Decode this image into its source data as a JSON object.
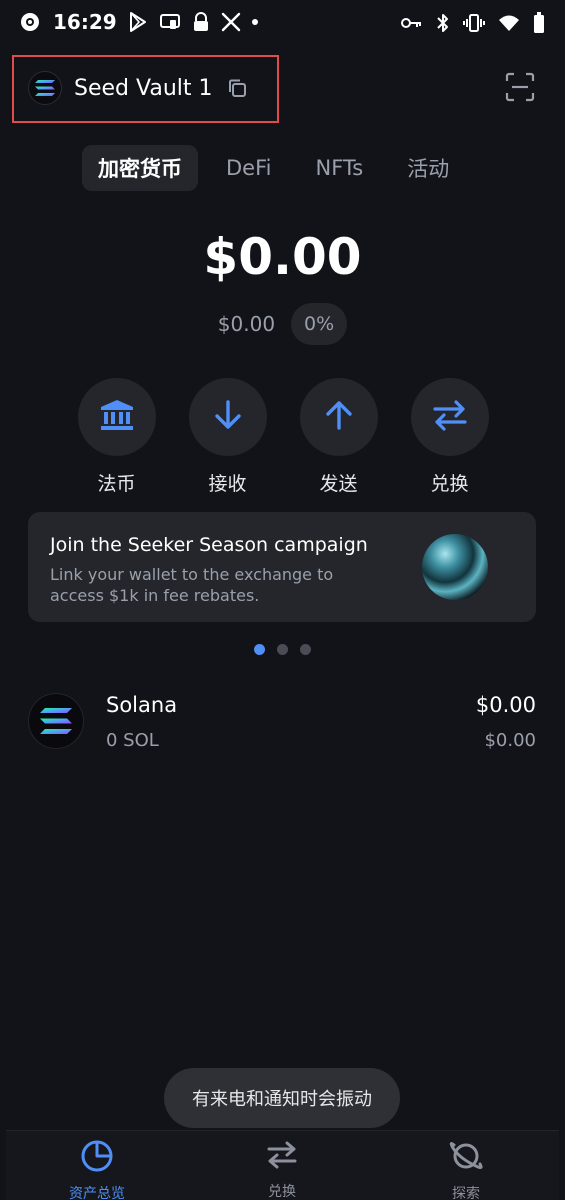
{
  "status_bar": {
    "time": "16:29",
    "left_icons": [
      "notification-app-icon",
      "play-store-icon",
      "cast-icon",
      "lock-icon",
      "x-app-icon",
      "dot-icon"
    ],
    "right_icons": [
      "vpn-key-icon",
      "bluetooth-icon",
      "vibrate-icon",
      "wifi-icon",
      "battery-icon"
    ]
  },
  "header": {
    "account_name": "Seed Vault 1",
    "copy_icon": "copy-icon",
    "scan_icon": "scan-icon"
  },
  "tabs": [
    {
      "label": "加密货币",
      "active": true
    },
    {
      "label": "DeFi",
      "active": false
    },
    {
      "label": "NFTs",
      "active": false
    },
    {
      "label": "活动",
      "active": false
    }
  ],
  "balance": {
    "total": "$0.00",
    "change_amount": "$0.00",
    "change_percent": "0%"
  },
  "actions": [
    {
      "label": "法币",
      "icon": "bank-icon"
    },
    {
      "label": "接收",
      "icon": "arrow-down-icon"
    },
    {
      "label": "发送",
      "icon": "arrow-up-icon"
    },
    {
      "label": "兑换",
      "icon": "swap-icon"
    }
  ],
  "banner": {
    "title": "Join the Seeker Season campaign",
    "description": "Link your wallet to the exchange to access $1k in fee rebates.",
    "page_count": 3,
    "active_page": 1
  },
  "tokens": [
    {
      "name": "Solana",
      "amount": "0 SOL",
      "value": "$0.00",
      "value_sub": "$0.00"
    }
  ],
  "toast": {
    "text": "有来电和通知时会振动"
  },
  "bottom_nav": [
    {
      "label": "资产总览",
      "icon": "pie-chart-icon",
      "active": true
    },
    {
      "label": "兑换",
      "icon": "swap-icon",
      "active": false
    },
    {
      "label": "探索",
      "icon": "planet-icon",
      "active": false
    }
  ],
  "colors": {
    "background": "#121318",
    "surface": "#24262c",
    "accent": "#4f8ff7",
    "text_secondary": "#9aa0ab",
    "highlight_border": "#e04b4b"
  }
}
